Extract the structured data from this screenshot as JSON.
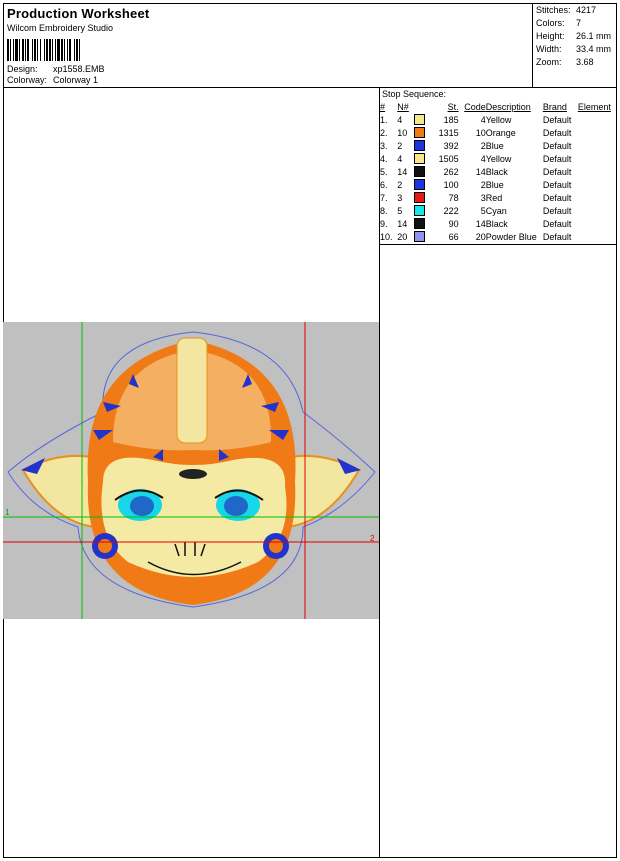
{
  "header": {
    "title": "Production Worksheet",
    "subtitle": "Wilcom Embroidery Studio",
    "design_label": "Design:",
    "design_value": "xp1558.EMB",
    "colorway_label": "Colorway:",
    "colorway_value": "Colorway 1"
  },
  "stats": [
    {
      "label": "Stitches:",
      "value": "4217"
    },
    {
      "label": "Colors:",
      "value": "7"
    },
    {
      "label": "Height:",
      "value": "26.1 mm"
    },
    {
      "label": "Width:",
      "value": "33.4 mm"
    },
    {
      "label": "Zoom:",
      "value": "3.68"
    }
  ],
  "stop_sequence": {
    "title": "Stop Sequence:",
    "headers": {
      "idx": "#",
      "n": "N#",
      "st": "St.",
      "code": "Code",
      "desc": "Description",
      "brand": "Brand",
      "element": "Element"
    },
    "rows": [
      {
        "idx": "1.",
        "n": "4",
        "color": "#f5e88a",
        "st": "185",
        "code": "4",
        "desc": "Yellow",
        "brand": "Default"
      },
      {
        "idx": "2.",
        "n": "10",
        "color": "#f07b16",
        "st": "1315",
        "code": "10",
        "desc": "Orange",
        "brand": "Default"
      },
      {
        "idx": "3.",
        "n": "2",
        "color": "#1c33e0",
        "st": "392",
        "code": "2",
        "desc": "Blue",
        "brand": "Default"
      },
      {
        "idx": "4.",
        "n": "4",
        "color": "#f5e88a",
        "st": "1505",
        "code": "4",
        "desc": "Yellow",
        "brand": "Default"
      },
      {
        "idx": "5.",
        "n": "14",
        "color": "#111111",
        "st": "262",
        "code": "14",
        "desc": "Black",
        "brand": "Default"
      },
      {
        "idx": "6.",
        "n": "2",
        "color": "#1c33e0",
        "st": "100",
        "code": "2",
        "desc": "Blue",
        "brand": "Default"
      },
      {
        "idx": "7.",
        "n": "3",
        "color": "#e21a1a",
        "st": "78",
        "code": "3",
        "desc": "Red",
        "brand": "Default"
      },
      {
        "idx": "8.",
        "n": "5",
        "color": "#16e6e8",
        "st": "222",
        "code": "5",
        "desc": "Cyan",
        "brand": "Default"
      },
      {
        "idx": "9.",
        "n": "14",
        "color": "#111111",
        "st": "90",
        "code": "14",
        "desc": "Black",
        "brand": "Default"
      },
      {
        "idx": "10.",
        "n": "20",
        "color": "#8f94f0",
        "st": "66",
        "code": "20",
        "desc": "Powder Blue",
        "brand": "Default"
      }
    ]
  },
  "preview": {
    "background": "#c0c0c0",
    "marker_1": "1",
    "marker_2": "2"
  }
}
